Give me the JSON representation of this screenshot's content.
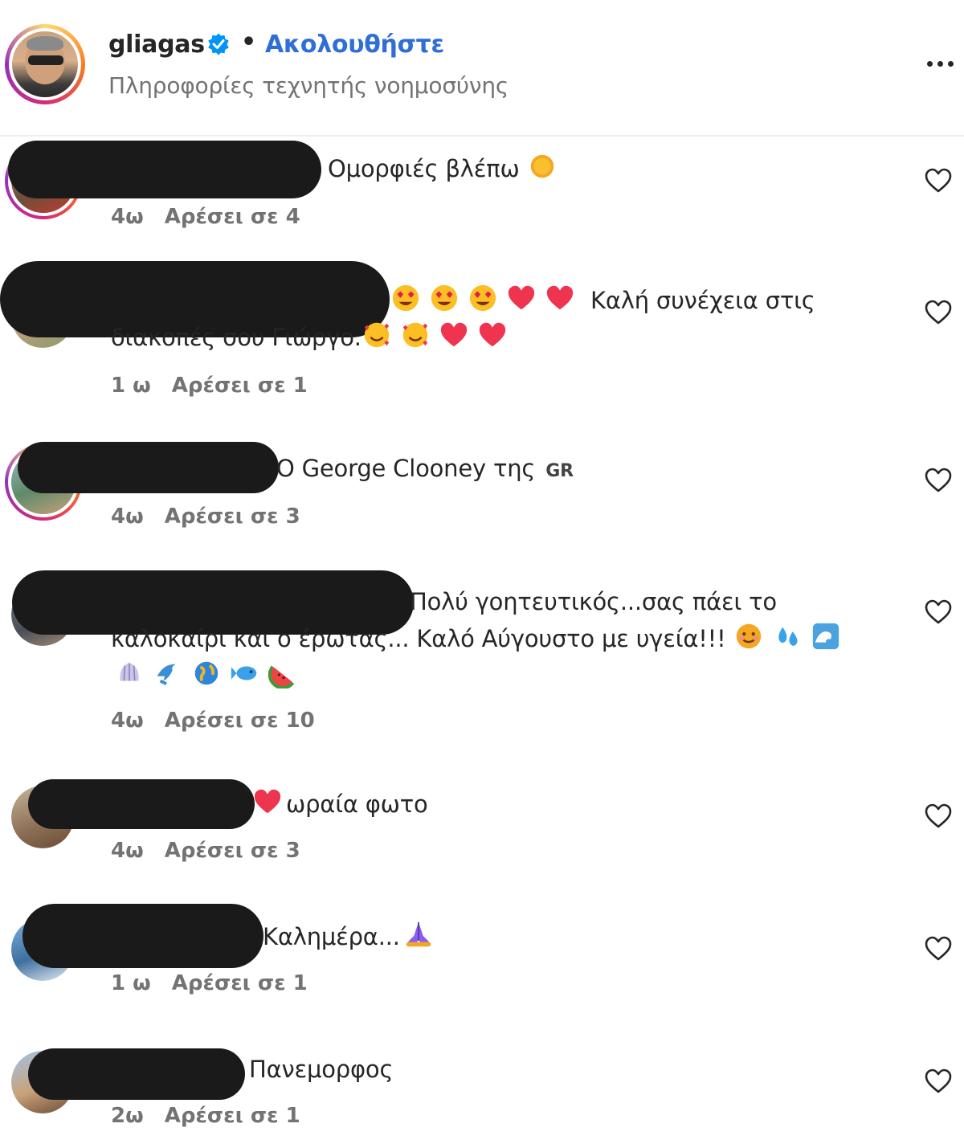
{
  "header": {
    "username": "gliagas",
    "follow_label": "Ακολουθήστε",
    "separator": "•",
    "subtitle": "Πληροφορίες τεχνητής νοημοσύνης"
  },
  "comments": [
    {
      "text": "Ομορφιές βλέπω",
      "emojis": [
        "sun"
      ],
      "time": "4ω",
      "likes": "Αρέσει σε 4"
    },
    {
      "text_line1": "Καλή συνέχεια στις",
      "text_line2": "διακοπές σου Γιώργο.",
      "emojis_line1": [
        "heart-eyes",
        "heart-eyes",
        "heart-eyes",
        "red-heart",
        "red-heart"
      ],
      "emojis_line2": [
        "smiling-hearts",
        "smiling-hearts",
        "red-heart",
        "red-heart"
      ],
      "time": "1 ω",
      "likes": "Αρέσει σε 1"
    },
    {
      "text": "O George Clooney της",
      "flag": "GR",
      "time": "4ω",
      "likes": "Αρέσει σε 3"
    },
    {
      "text_line1": "Πολύ γοητευτικός...σας πάει το",
      "text_line2": "καλοκαίρι και ο έρωτας... Καλό Αύγουστο με υγεία!!!",
      "emojis_line2": [
        "smiling-face",
        "droplets",
        "wave"
      ],
      "emojis_line3": [
        "shell",
        "dolphin",
        "globe",
        "fish",
        "watermelon"
      ],
      "time": "4ω",
      "likes": "Αρέσει σε 10"
    },
    {
      "text": "ωραία φωτο",
      "emojis": [
        "red-heart"
      ],
      "time": "4ω",
      "likes": "Αρέσει σε 3"
    },
    {
      "text": "Καλημέρα...",
      "emojis": [
        "folded-hands"
      ],
      "time": "1 ω",
      "likes": "Αρέσει σε 1"
    },
    {
      "text": "Πανεμορφος",
      "time": "2ω",
      "likes": "Αρέσει σε 1"
    }
  ],
  "icons": {
    "more": "more-options-icon",
    "like": "heart-outline-icon",
    "verified": "verified-badge-icon"
  },
  "colors": {
    "link_blue": "#2f6ed6",
    "secondary_text": "#737373",
    "verified_blue": "#0095f6"
  }
}
